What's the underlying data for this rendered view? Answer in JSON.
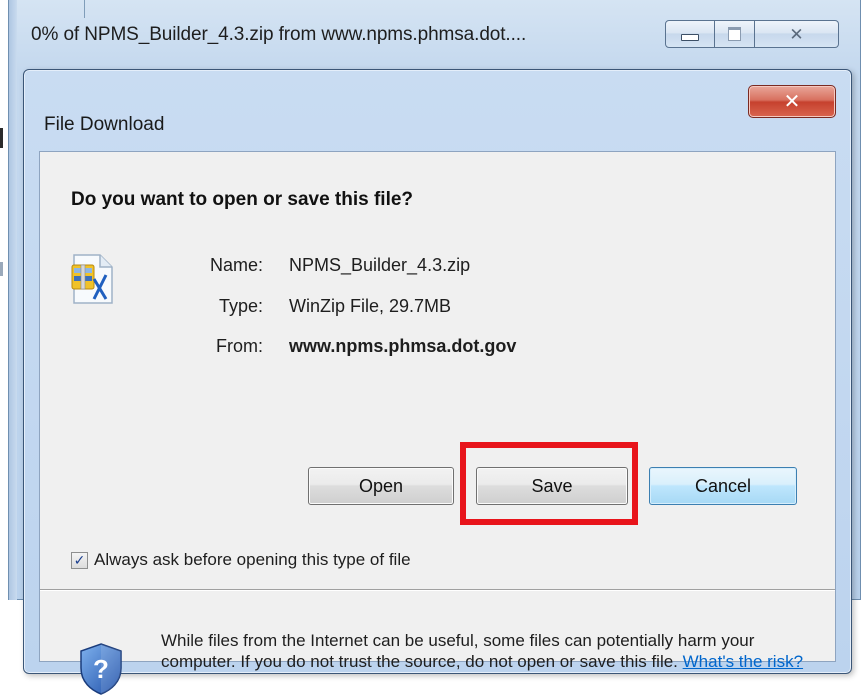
{
  "progress_window": {
    "title": "0% of NPMS_Builder_4.3.zip from www.npms.phmsa.dot...."
  },
  "dialog": {
    "title": "File Download",
    "question": "Do you want to open or save this file?",
    "file": {
      "name_label": "Name:",
      "name_value": "NPMS_Builder_4.3.zip",
      "type_label": "Type:",
      "type_value": "WinZip File, 29.7MB",
      "from_label": "From:",
      "from_value": "www.npms.phmsa.dot.gov",
      "icon": "zip-file-icon"
    },
    "buttons": {
      "open": "Open",
      "save": "Save",
      "cancel": "Cancel"
    },
    "highlighted_button": "Save",
    "highlight_color": "#e8141b",
    "checkbox": {
      "label": "Always ask before opening this type of file",
      "checked": true
    },
    "warning": {
      "icon": "shield-question-icon",
      "text": "While files from the Internet can be useful, some files can potentially harm your computer. If you do not trust the source, do not open or save this file.",
      "link": "What's the risk?"
    }
  }
}
